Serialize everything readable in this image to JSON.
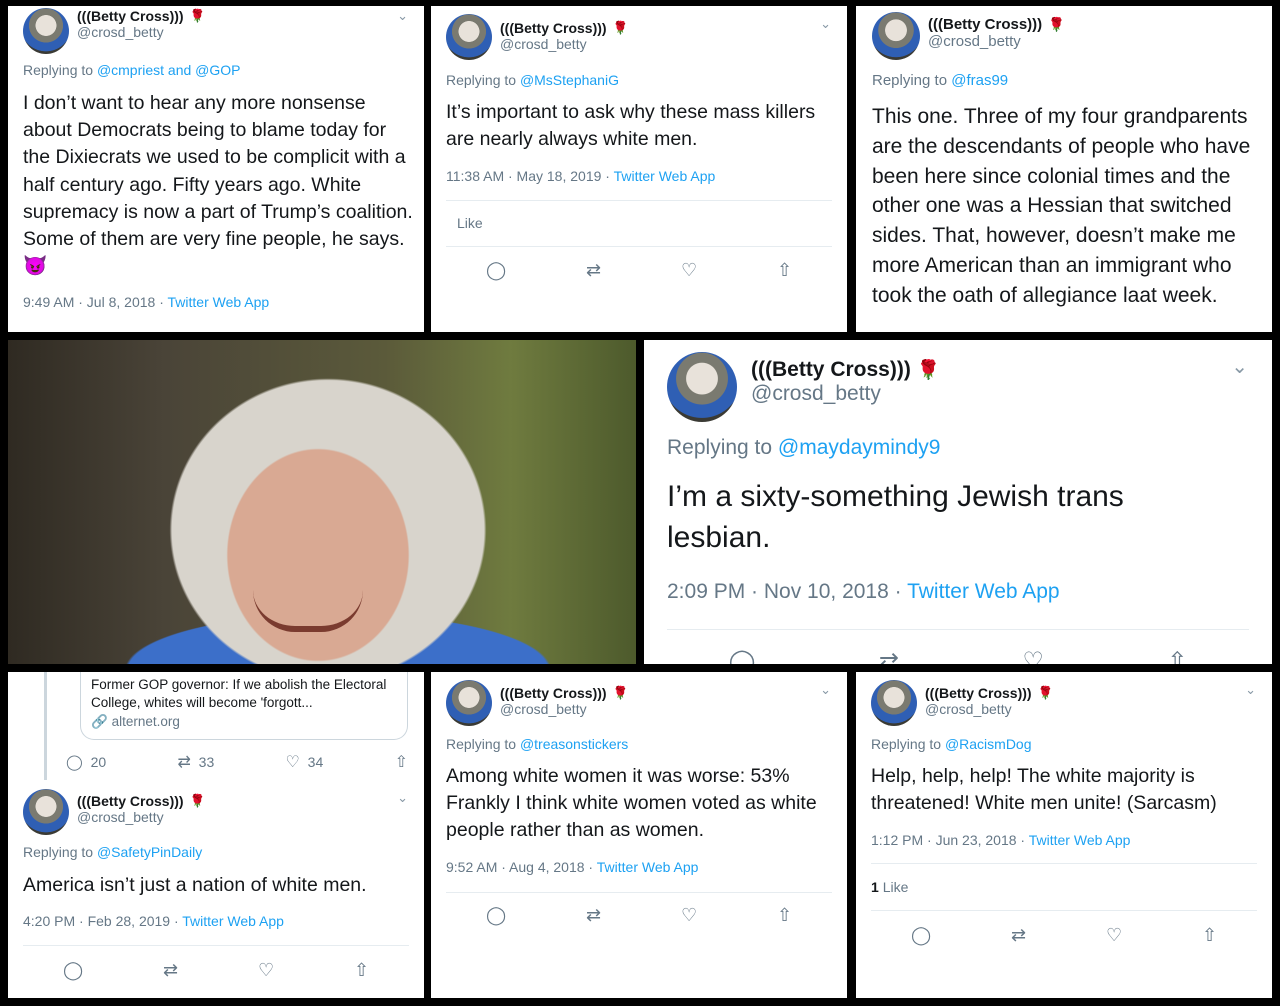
{
  "tweets": [
    {
      "display_name": "(((Betty Cross)))",
      "handle": "@crosd_betty",
      "replying_prefix": "Replying to",
      "replying_to": "@cmpriest and @GOP",
      "text": "I don’t want to hear any more nonsense about Democrats being to blame today for the Dixiecrats we used to be complicit with a half century ago. Fifty years ago. White supremacy is now a part of Trump’s coalition. Some of them are very fine people, he says. 😈",
      "time": "9:49 AM · Jul 8, 2018 ·",
      "source": "Twitter Web App"
    },
    {
      "display_name": "(((Betty Cross)))",
      "handle": "@crosd_betty",
      "replying_prefix": "Replying to",
      "replying_to": "@MsStephaniG",
      "text": "It’s important to ask why these mass killers are nearly always white men.",
      "time": "11:38 AM · May 18, 2019 ·",
      "source": "Twitter Web App",
      "likes_label": "Like"
    },
    {
      "display_name": "(((Betty Cross)))",
      "handle": "@crosd_betty",
      "replying_prefix": "Replying to",
      "replying_to": "@fras99",
      "text": "This one. Three of my four grandparents are the descendants of people who have been here since colonial times and the other one was a Hessian that switched sides. That, however, doesn’t make me more American than an immigrant who took the oath of allegiance laat week."
    },
    {
      "display_name": "(((Betty Cross)))",
      "handle": "@crosd_betty",
      "replying_prefix": "Replying to",
      "replying_to": "@maydaymindy9",
      "text": "I’m a sixty-something Jewish trans lesbian.",
      "time": "2:09 PM · Nov 10, 2018 ·",
      "source": "Twitter Web App"
    },
    {
      "card_title": "Former GOP governor: If we abolish the Electoral College, whites will become 'forgott...",
      "card_domain": "alternet.org",
      "reply_count": "20",
      "retweet_count": "33",
      "like_count": "34",
      "display_name": "(((Betty Cross)))",
      "handle": "@crosd_betty",
      "replying_prefix": "Replying to",
      "replying_to": "@SafetyPinDaily",
      "text": "America isn’t just a nation of white men.",
      "time": "4:20 PM · Feb 28, 2019 ·",
      "source": "Twitter Web App"
    },
    {
      "display_name": "(((Betty Cross)))",
      "handle": "@crosd_betty",
      "replying_prefix": "Replying to",
      "replying_to": "@treasonstickers",
      "text": "Among white women it was worse: 53% Frankly I think white women voted as white people rather than as women.",
      "time": "9:52 AM · Aug 4, 2018 ·",
      "source": "Twitter Web App"
    },
    {
      "display_name": "(((Betty Cross)))",
      "handle": "@crosd_betty",
      "replying_prefix": "Replying to",
      "replying_to": "@RacismDog",
      "text": "Help, help, help! The white majority is threatened! White men unite! (Sarcasm)",
      "time": "1:12 PM · Jun 23, 2018 ·",
      "source": "Twitter Web App",
      "likes_count": "1",
      "likes_label": "Like"
    }
  ],
  "icons": {
    "reply": "speech-bubble",
    "retweet": "retweet-arrows",
    "like": "heart",
    "share": "share-upload",
    "rose": "rose",
    "chevron": "chevron-down",
    "link": "link"
  },
  "colors": {
    "link": "#1da1f2",
    "secondary": "#657786",
    "rose": "#c4202a"
  }
}
